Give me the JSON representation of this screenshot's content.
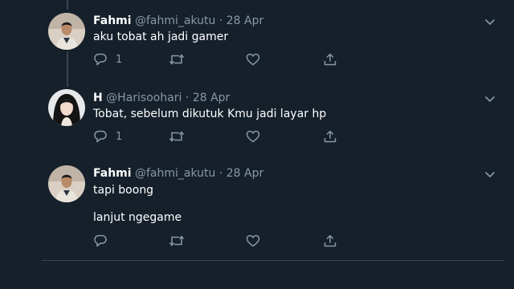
{
  "tweets": [
    {
      "name": "Fahmi",
      "handle": "@fahmi_akutu",
      "separator": "·",
      "date": "28 Apr",
      "lines": [
        "aku tobat ah jadi gamer"
      ],
      "reply_count": "1",
      "retweet_count": "",
      "like_count": ""
    },
    {
      "name": "H",
      "handle": "@Harisoohari",
      "separator": "·",
      "date": "28 Apr",
      "lines": [
        "Tobat, sebelum dikutuk Kmu jadi layar hp"
      ],
      "reply_count": "1",
      "retweet_count": "",
      "like_count": ""
    },
    {
      "name": "Fahmi",
      "handle": "@fahmi_akutu",
      "separator": "·",
      "date": "28 Apr",
      "lines": [
        "tapi boong",
        "lanjut ngegame"
      ],
      "reply_count": "",
      "retweet_count": "",
      "like_count": ""
    }
  ],
  "colors": {
    "background": "#15202b",
    "text": "#ffffff",
    "muted": "#8899a6",
    "divider": "#38444d"
  },
  "icons": {
    "reply": "reply-icon",
    "retweet": "retweet-icon",
    "like": "like-icon",
    "share": "share-icon",
    "menu": "chevron-down-icon"
  }
}
